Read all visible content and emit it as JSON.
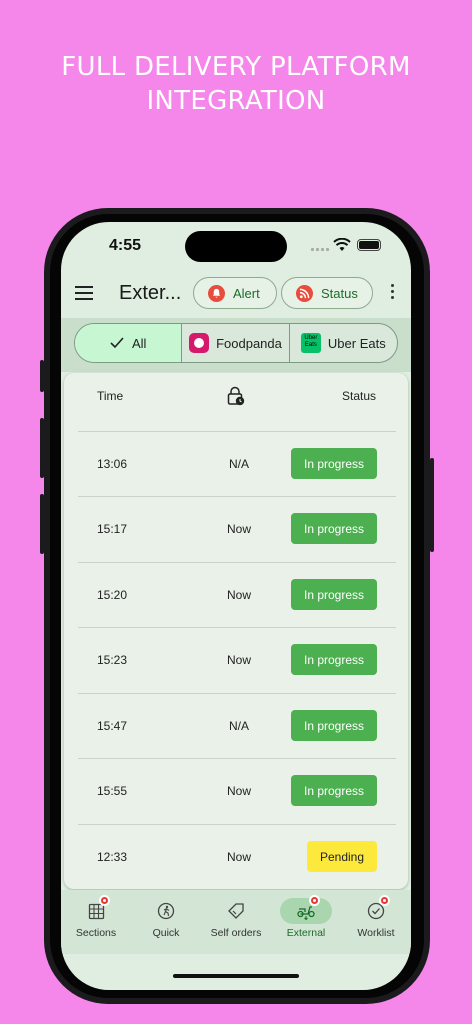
{
  "headline": {
    "line1": "FULL DELIVERY PLATFORM",
    "line2": "INTEGRATION"
  },
  "status_bar": {
    "time": "4:55"
  },
  "appbar": {
    "title": "Exter...",
    "alert_label": "Alert",
    "status_label": "Status"
  },
  "platform_tabs": [
    {
      "label": "All",
      "selected": true,
      "icon": "check-icon"
    },
    {
      "label": "Foodpanda",
      "selected": false,
      "icon": "foodpanda-logo"
    },
    {
      "label": "Uber Eats",
      "selected": false,
      "icon": "ubereats-logo",
      "logo_text": "Uber Eats"
    }
  ],
  "table": {
    "columns": {
      "time": "Time",
      "eta_icon": "lock-clock-icon",
      "status": "Status"
    },
    "rows": [
      {
        "time": "13:06",
        "eta": "N/A",
        "status": "In progress"
      },
      {
        "time": "15:17",
        "eta": "Now",
        "status": "In progress"
      },
      {
        "time": "15:20",
        "eta": "Now",
        "status": "In progress"
      },
      {
        "time": "15:23",
        "eta": "Now",
        "status": "In progress"
      },
      {
        "time": "15:47",
        "eta": "N/A",
        "status": "In progress"
      },
      {
        "time": "15:55",
        "eta": "Now",
        "status": "In progress"
      },
      {
        "time": "12:33",
        "eta": "Now",
        "status": "Pending"
      }
    ]
  },
  "bottom_nav": [
    {
      "label": "Sections",
      "icon": "grid-icon",
      "badge": true,
      "active": false
    },
    {
      "label": "Quick",
      "icon": "running-icon",
      "badge": false,
      "active": false
    },
    {
      "label": "Self orders",
      "icon": "tag-icon",
      "badge": false,
      "active": false
    },
    {
      "label": "External",
      "icon": "scooter-icon",
      "badge": true,
      "active": true
    },
    {
      "label": "Worklist",
      "icon": "check-circle-icon",
      "badge": true,
      "active": false
    }
  ],
  "colors": {
    "background": "#f586ea",
    "progress": "#4caf50",
    "pending": "#fde93b",
    "accent": "#1e6b2a"
  }
}
